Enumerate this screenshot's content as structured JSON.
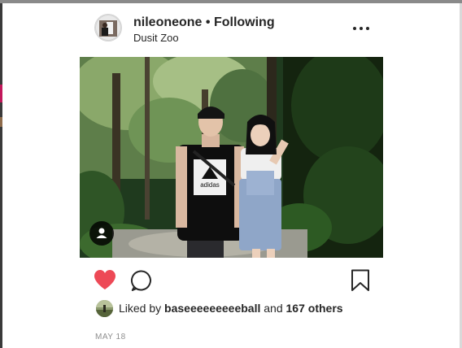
{
  "post": {
    "username": "nileoneone",
    "separator": " • ",
    "follow_status": "Following",
    "location": "Dusit Zoo",
    "more_icon": "more-options-icon",
    "photo": {
      "description_icon": "photo",
      "shirt_text": "adidas"
    },
    "actions": {
      "like_icon": "heart-filled-icon",
      "like_color": "#ed4956",
      "comment_icon": "comment-icon",
      "save_icon": "bookmark-icon"
    },
    "likes": {
      "prefix": "Liked by ",
      "user": "baseeeeeeeeeball",
      "middle": " and ",
      "others": "167 others"
    },
    "date": "MAY 18"
  }
}
